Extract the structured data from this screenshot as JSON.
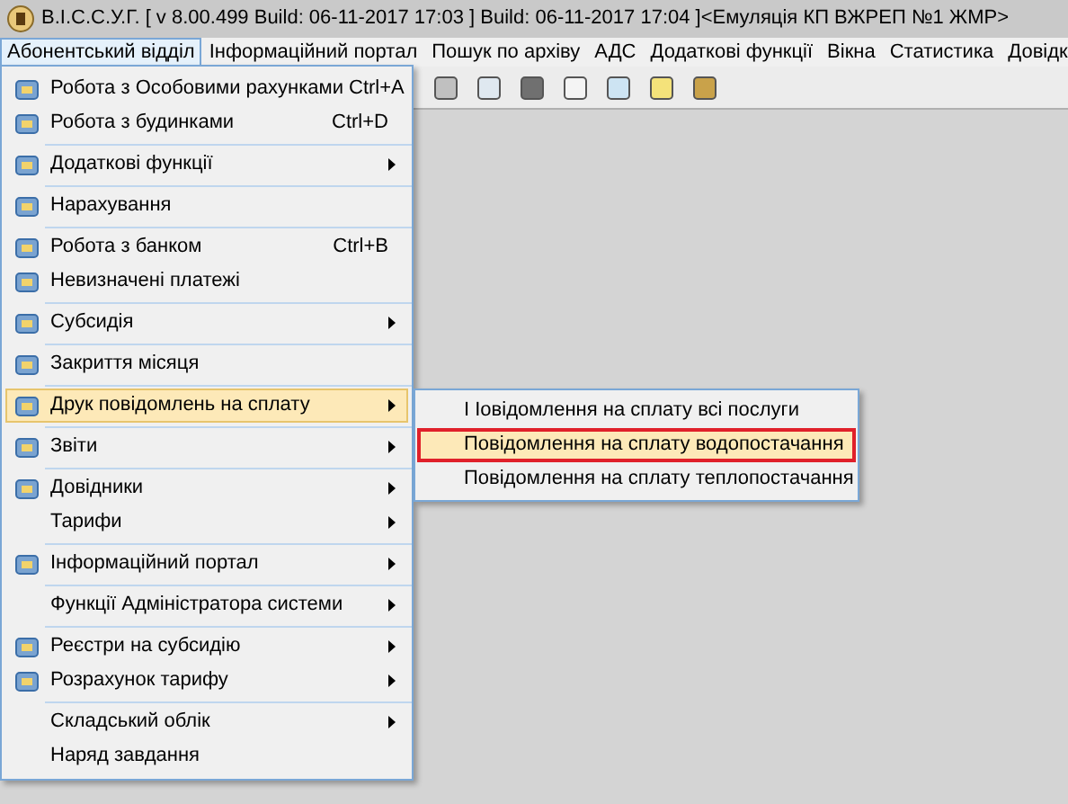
{
  "window": {
    "title": "В.І.С.С.У.Г. [ v 8.00.499 Build: 06-11-2017 17:03 ]   Build: 06-11-2017 17:04 ]<Емуляція КП ВЖРЕП №1 ЖМР>"
  },
  "menubar": [
    {
      "label": "Абонентський відділ",
      "selected": true
    },
    {
      "label": "Інформаційний портал",
      "selected": false
    },
    {
      "label": "Пошук по архіву",
      "selected": false
    },
    {
      "label": "АДС",
      "selected": false
    },
    {
      "label": "Додаткові функції",
      "selected": false
    },
    {
      "label": "Вікна",
      "selected": false
    },
    {
      "label": "Статистика",
      "selected": false
    },
    {
      "label": "Довідк",
      "selected": false
    }
  ],
  "menu": {
    "groups": [
      [
        {
          "label": "Робота з Особовими рахунками",
          "shortcut": "Ctrl+A",
          "has_icon": true,
          "submenu": false,
          "selected": false
        },
        {
          "label": "Робота з будинками",
          "shortcut": "Ctrl+D",
          "has_icon": true,
          "submenu": false,
          "selected": false
        }
      ],
      [
        {
          "label": "Додаткові функції",
          "has_icon": true,
          "submenu": true,
          "selected": false
        }
      ],
      [
        {
          "label": "Нарахування",
          "has_icon": true,
          "submenu": false,
          "selected": false
        }
      ],
      [
        {
          "label": "Робота з банком",
          "shortcut": "Ctrl+B",
          "has_icon": true,
          "submenu": false,
          "selected": false
        },
        {
          "label": "Невизначені платежі",
          "has_icon": true,
          "submenu": false,
          "selected": false
        }
      ],
      [
        {
          "label": "Субсидія",
          "has_icon": true,
          "submenu": true,
          "selected": false
        }
      ],
      [
        {
          "label": "Закриття місяця",
          "has_icon": true,
          "submenu": false,
          "selected": false
        }
      ],
      [
        {
          "label": "Друк повідомлень на сплату",
          "has_icon": true,
          "submenu": true,
          "selected": true
        }
      ],
      [
        {
          "label": "Звіти",
          "has_icon": true,
          "submenu": true,
          "selected": false
        }
      ],
      [
        {
          "label": "Довідники",
          "has_icon": true,
          "submenu": true,
          "selected": false
        },
        {
          "label": "Тарифи",
          "has_icon": false,
          "submenu": true,
          "selected": false
        }
      ],
      [
        {
          "label": "Інформаційний портал",
          "has_icon": true,
          "submenu": true,
          "selected": false
        }
      ],
      [
        {
          "label": "Функції Адміністратора системи",
          "has_icon": false,
          "submenu": true,
          "selected": false
        }
      ],
      [
        {
          "label": "Реєстри на субсидію",
          "has_icon": true,
          "submenu": true,
          "selected": false
        },
        {
          "label": "Розрахунок тарифу",
          "has_icon": true,
          "submenu": true,
          "selected": false
        }
      ],
      [
        {
          "label": "Складський облік",
          "has_icon": false,
          "submenu": true,
          "selected": false
        },
        {
          "label": "Наряд завдання",
          "has_icon": false,
          "submenu": false,
          "selected": false
        }
      ]
    ]
  },
  "submenu": [
    {
      "label": "I Іовідомлення на сплату всі послуги",
      "selected": false,
      "outlined": false
    },
    {
      "label": "Повідомлення на сплату водопостачання",
      "selected": true,
      "outlined": true
    },
    {
      "label": "Повідомлення на сплату теплопостачання",
      "selected": false,
      "outlined": false
    }
  ]
}
